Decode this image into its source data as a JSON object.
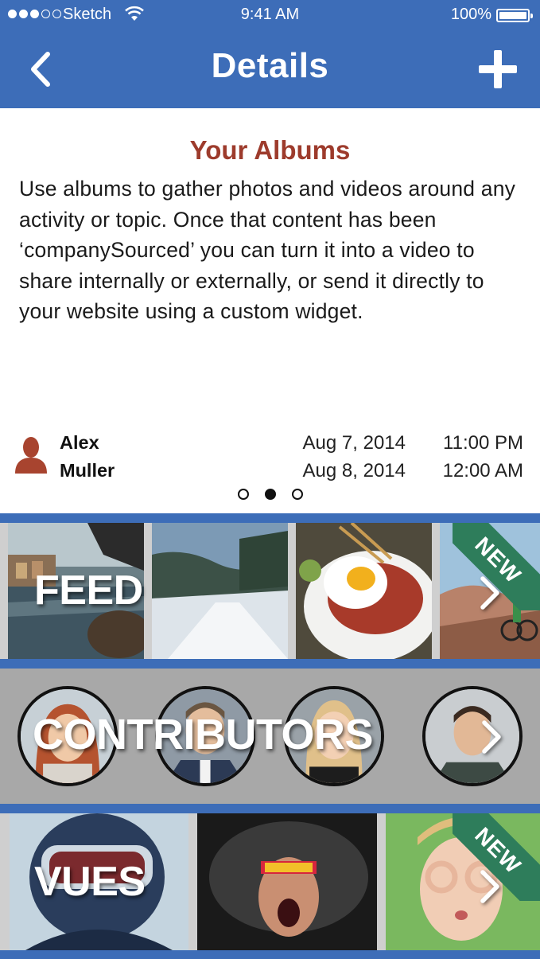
{
  "status_bar": {
    "carrier": "Sketch",
    "time": "9:41 AM",
    "battery": "100%",
    "battery_level": 1.0,
    "signal_bars_filled": 3,
    "signal_bars_total": 5
  },
  "nav": {
    "title": "Details",
    "back_icon": "chevron-left-icon",
    "add_icon": "plus-icon"
  },
  "album": {
    "title": "Your Albums",
    "description": "Use albums to gather photos and videos around any activity or topic. Once that content has been ‘companySourced’ you can turn it into a video to share internally or externally, or send it directly to your website using a custom widget.",
    "author_first": "Alex",
    "author_last": "Muller",
    "start_date": "Aug 7, 2014",
    "end_date": "Aug 8, 2014",
    "start_time": "11:00 PM",
    "end_time": "12:00 AM",
    "pager_total": 3,
    "pager_active": 2
  },
  "sections": {
    "feed": {
      "label": "FEED",
      "badge": "NEW"
    },
    "contributors": {
      "label": "CONTRIBUTORS"
    },
    "vues": {
      "label": "VUES",
      "badge": "NEW"
    }
  },
  "colors": {
    "brand_blue": "#3d6db8",
    "title_red": "#9d3b2c",
    "ribbon_green": "#2e7d5b"
  }
}
